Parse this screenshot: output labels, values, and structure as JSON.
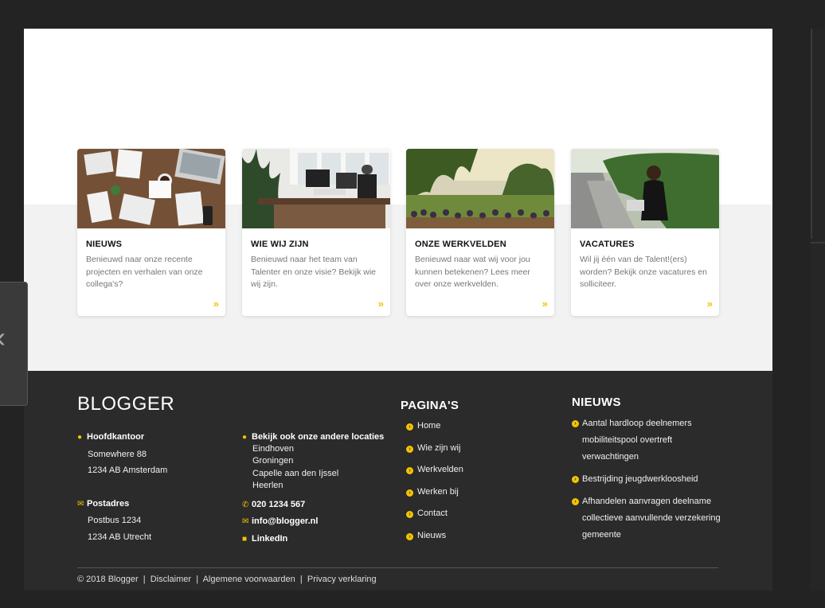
{
  "cards": [
    {
      "title": "NIEUWS",
      "text": "Benieuwd naar onze recente projecten en verhalen van onze collega's?",
      "more": "»"
    },
    {
      "title": "WIE WIJ ZIJN",
      "text": "Benieuwd naar het team van Talenter en onze visie? Bekijk wie wij zijn.",
      "more": "»"
    },
    {
      "title": "ONZE WERKVELDEN",
      "text": "Benieuwd naar wat wij voor jou kunnen betekenen? Lees meer over onze werkvelden.",
      "more": "»"
    },
    {
      "title": "VACATURES",
      "text": "Wil jij één van de Talent!(ers) worden? Bekijk onze vacatures en solliciteer.",
      "more": "»"
    }
  ],
  "footer": {
    "logo": "BLOGGER",
    "hq": {
      "label": "Hoofdkantoor",
      "line1": "Somewhere 88",
      "line2": "1234 AB Amsterdam"
    },
    "postal": {
      "label": "Postadres",
      "line1": "Postbus 1234",
      "line2": "1234 AB  Utrecht"
    },
    "locations": {
      "label": "Bekijk ook onze andere locaties",
      "items": [
        "Eindhoven",
        "Groningen",
        "Capelle aan den Ijssel",
        "Heerlen"
      ]
    },
    "phone": "020 1234 567",
    "email": "info@blogger.nl",
    "linkedin": "LinkedIn",
    "pages_title": "PAGINA'S",
    "pages": [
      "Home",
      "Wie zijn wij",
      "Werkvelden",
      "Werken bij",
      "Contact",
      "Nieuws"
    ],
    "news_title": "NIEUWS",
    "news": [
      "Aantal hardloop deelnemers mobiliteitspool overtreft verwachtingen",
      "Bestrijding jeugdwerkloosheid",
      "Afhandelen aanvragen deelname collectieve aanvullende verzekering gemeente"
    ],
    "bottom": {
      "copyright": "© 2018 Blogger",
      "sep": "|",
      "disclaimer": "Disclaimer",
      "terms": "Algemene voorwaarden",
      "privacy": "Privacy verklaring"
    }
  },
  "icons": {
    "pin": "map-pin-icon",
    "envelope": "envelope-icon",
    "phone": "phone-icon",
    "linkedin": "linkedin-icon",
    "arrow": "chevron-circle-right-icon",
    "prev": "chevron-left-icon"
  },
  "colors": {
    "accent": "#f5c400",
    "footer_bg": "#2b2b2b",
    "band_bg": "#f2f2f2"
  }
}
